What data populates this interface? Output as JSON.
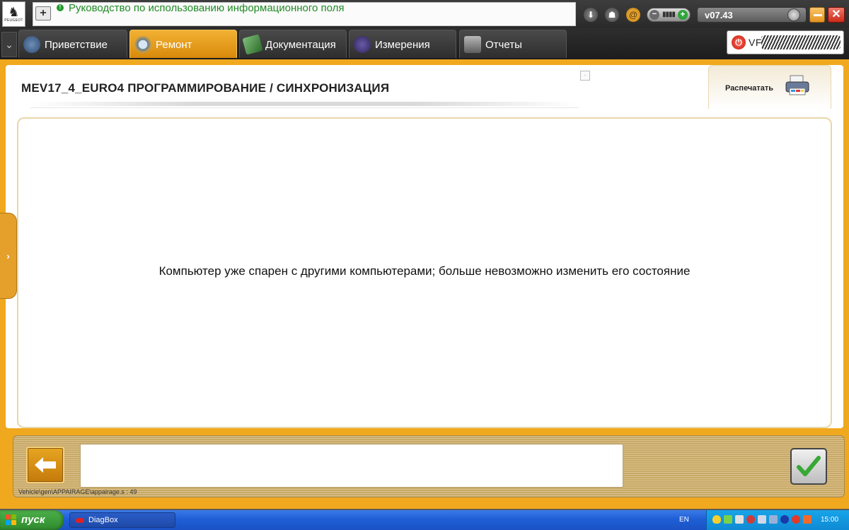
{
  "topbar": {
    "logo_brand": "PEUGEOT",
    "guide_text": "Руководство по использованию информационного поля",
    "version": "v07.43"
  },
  "tabs": [
    {
      "label": "Приветствие",
      "icon": "welcome-globe-icon"
    },
    {
      "label": "Ремонт",
      "icon": "magnifier-icon",
      "active": true
    },
    {
      "label": "Документация",
      "icon": "book-icon"
    },
    {
      "label": "Измерения",
      "icon": "waveform-icon"
    },
    {
      "label": "Отчеты",
      "icon": "report-icon"
    }
  ],
  "vehicle": {
    "vin_prefix": "VF"
  },
  "main": {
    "title": "MEV17_4_EURO4  ПРОГРАММИРОВАНИЕ / СИНХРОНИЗАЦИЯ",
    "print_label": "Распечатать",
    "message": "Компьютер уже спарен с другими компьютерами; больше невозможно изменить его состояние"
  },
  "bottom": {
    "status_value": "",
    "path": "Vehicle\\gen\\APPAIRAGE\\appairage.s : 49"
  },
  "taskbar": {
    "start_label": "пуск",
    "task_item": "DiagBox",
    "lang": "EN",
    "clock": "15:00"
  },
  "colors": {
    "accent": "#f0a81e",
    "guide_text": "#1f8a24",
    "taskbar": "#1f5fd6"
  }
}
